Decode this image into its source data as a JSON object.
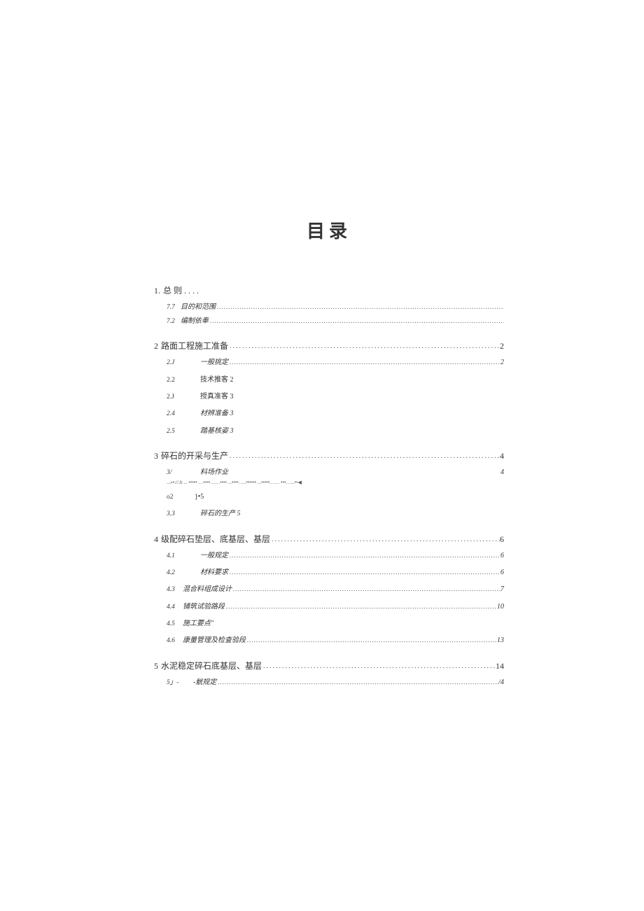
{
  "title": "目录",
  "s1": {
    "heading_num": "1.",
    "heading_label": "总 则 . . . .",
    "i1_num": "7.7",
    "i1_label": "目的和范围",
    "i2_num": "7.2",
    "i2_label": "编制依奉"
  },
  "s2": {
    "heading_num": "2",
    "heading_label": "路面工程施工准备",
    "heading_page": "2",
    "i1_num": "2.J",
    "i1_label": "一般挑定",
    "i1_page": "2",
    "i2_num": "2.2",
    "i2_label": "技术推客 2",
    "i3_num": "2.J",
    "i3_label": "授真准客 3",
    "i4_num": "2.4",
    "i4_label": "材辨准备 3",
    "i5_num": "2.5",
    "i5_label": "踏基核姿 3"
  },
  "s3": {
    "heading_num": "3",
    "heading_label": "碎石的开采与生产",
    "heading_page": "4",
    "i1_num": "3/",
    "i1_label": "料场作业",
    "i1_page": "4",
    "under_text": "...»•://.lt ... ••••• …••••……•••• ...••••…..•••••• ...•••••…… •••…...••◀",
    "i2_num": "o2",
    "i2_label": "}•5",
    "i3_num": "3.3",
    "i3_label": "碎石的生产 5"
  },
  "s4": {
    "heading_num": "4",
    "heading_label": "级配碎石垫层、底基层、基层",
    "heading_page": "6",
    "i1_num": "4.1",
    "i1_label": "一般规定",
    "i1_page": "6",
    "i2_num": "4.2",
    "i2_label": "材料要求",
    "i2_page": "6",
    "i3_num": "4.3",
    "i3_label": "混合料组成设计",
    "i3_page": "7",
    "i4_num": "4.4",
    "i4_label": "铺筑试验路段",
    "i4_page": "10",
    "i5_num": "4.5",
    "i5_label": "施工要点\"",
    "i6_num": "4.6",
    "i6_label": "康量管理及检查验段",
    "i6_page": "13"
  },
  "s5": {
    "heading_num": "5",
    "heading_label": "水泥稳定碎石底基层、基层",
    "heading_page": "14",
    "i1_num": "5」-",
    "i1_label": "-觥规定",
    "i1_page": "/4"
  }
}
